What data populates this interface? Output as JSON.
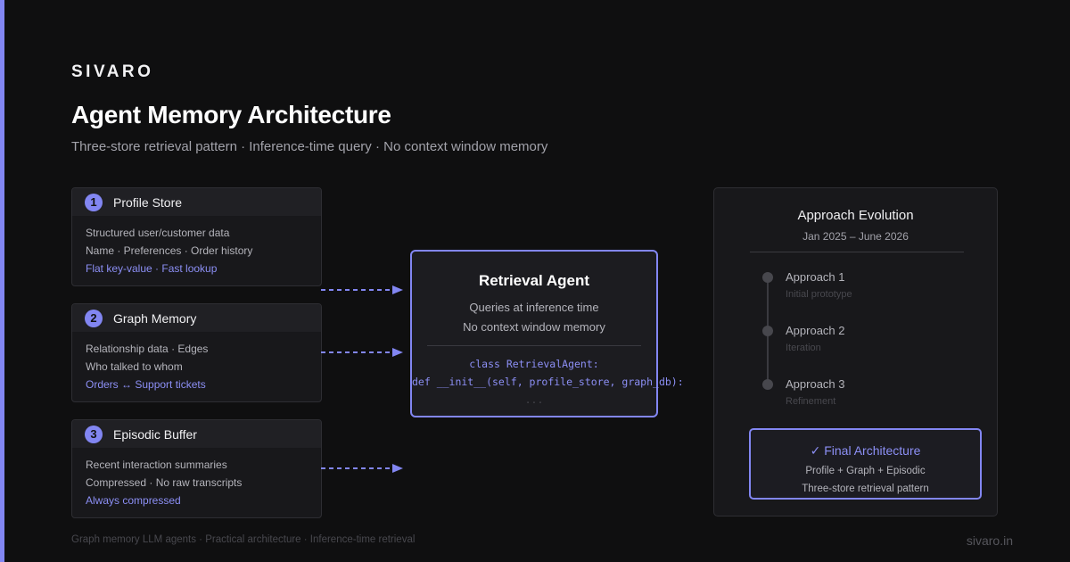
{
  "brand": "SIVARO",
  "header": {
    "title": "Agent Memory Architecture",
    "subtitle": "Three-store retrieval pattern · Inference-time query · No context window memory"
  },
  "stores": [
    {
      "number": "1",
      "title": "Profile Store",
      "lines": [
        "Structured user/customer data",
        "Name · Preferences · Order history"
      ],
      "highlight": "Flat key-value · Fast lookup"
    },
    {
      "number": "2",
      "title": "Graph Memory",
      "lines": [
        "Relationship data · Edges",
        "Who talked to whom"
      ],
      "highlight": "Orders ↔ Support tickets"
    },
    {
      "number": "3",
      "title": "Episodic Buffer",
      "lines": [
        "Recent interaction summaries",
        "Compressed · No raw transcripts"
      ],
      "highlight": "Always compressed"
    }
  ],
  "agent": {
    "title": "Retrieval Agent",
    "lines": [
      "Queries at inference time",
      "No context window memory"
    ],
    "code": [
      "class RetrievalAgent:",
      "def __init__(self, profile_store, graph_db):",
      "..."
    ]
  },
  "evolution": {
    "title": "Approach Evolution",
    "range": "Jan 2025 – June 2026",
    "items": [
      {
        "label": "Approach 1",
        "note": "Initial prototype"
      },
      {
        "label": "Approach 2",
        "note": "Iteration"
      },
      {
        "label": "Approach 3",
        "note": "Refinement"
      }
    ],
    "final": {
      "title": "✓ Final Architecture",
      "lines": [
        "Profile + Graph + Episodic",
        "Three-store retrieval pattern"
      ]
    }
  },
  "footer": {
    "left": "Graph memory LLM agents · Practical architecture · Inference-time retrieval",
    "right": "sivaro.in"
  },
  "colors": {
    "accent": "#8286f2",
    "background": "#0f0f10",
    "card": "#18181b"
  }
}
